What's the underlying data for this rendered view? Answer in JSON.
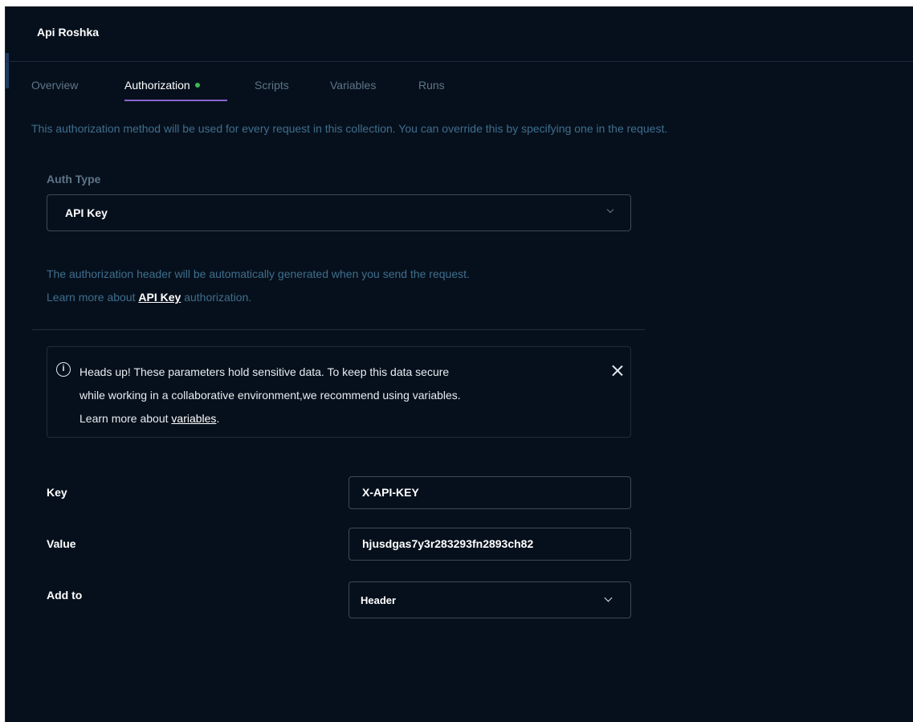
{
  "collection": {
    "title": "Api Roshka"
  },
  "tabs": [
    {
      "label": "Overview"
    },
    {
      "label": "Authorization"
    },
    {
      "label": "Scripts"
    },
    {
      "label": "Variables"
    },
    {
      "label": "Runs"
    }
  ],
  "description": "This authorization method will be used for every request in this collection. You can override this by specifying one in the request.",
  "auth": {
    "type_label": "Auth Type",
    "type_value": "API Key",
    "help_line1": "The authorization header will be automatically generated when you send the request.",
    "help_line2_prefix": "Learn more about ",
    "help_link": "API Key",
    "help_line2_suffix": " authorization."
  },
  "notice": {
    "text_line1": "Heads up! These parameters hold sensitive data. To keep this data secure",
    "text_line2": "while working in a collaborative environment,we recommend using variables.",
    "text_line3_prefix": "Learn more about ",
    "text_link": "variables",
    "text_line3_suffix": "."
  },
  "fields": {
    "key_label": "Key",
    "key_value": "X-API-KEY",
    "value_label": "Value",
    "value_value": "hjusdgas7y3r283293fn2893ch82",
    "add_to_label": "Add to",
    "add_to_value": "Header"
  },
  "colors": {
    "background": "#06101c",
    "accent_underline": "#8a63d2",
    "status_dot": "#3fb950",
    "muted_text": "#5e7487",
    "description_text": "#3f6e8d"
  },
  "icons": {
    "info": "info-icon",
    "close": "close-icon",
    "dropdown": "chevron-down-icon"
  }
}
